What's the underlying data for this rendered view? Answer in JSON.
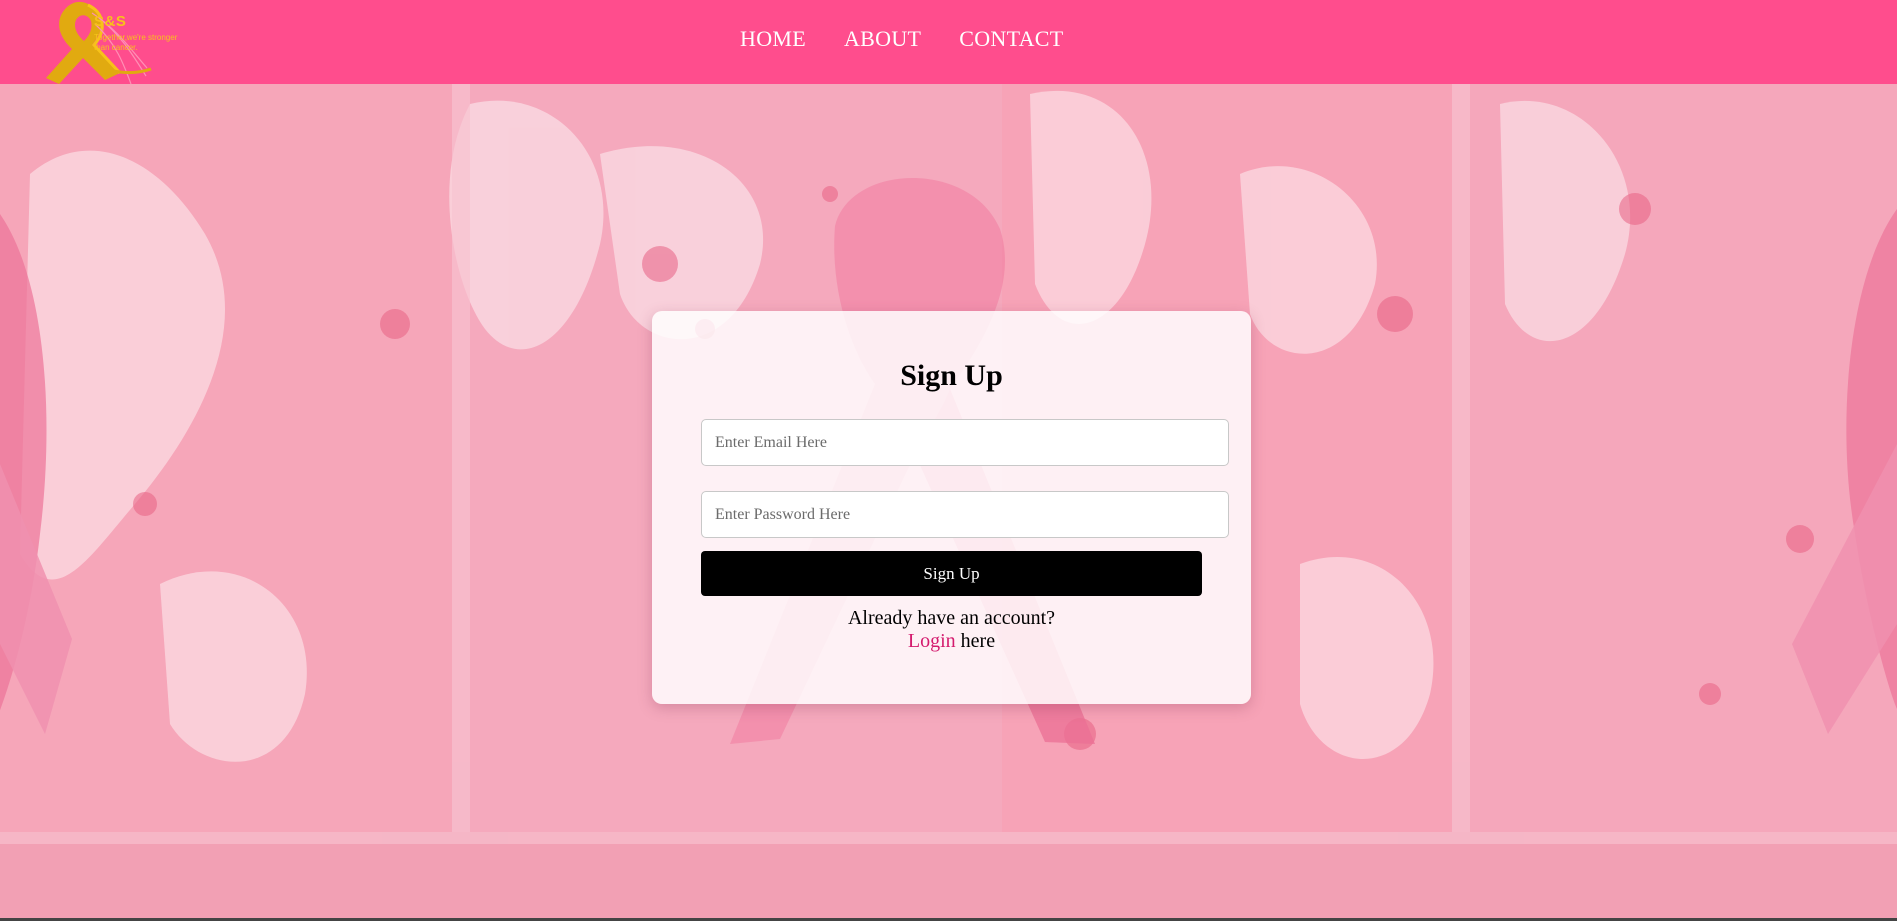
{
  "brand": {
    "name": "S&S",
    "tagline": "Together,we're stronger than cancer."
  },
  "nav": {
    "home": "HOME",
    "about": "ABOUT",
    "contact": "CONTACT"
  },
  "form": {
    "title": "Sign Up",
    "email_placeholder": "Enter Email Here",
    "email_value": "",
    "password_placeholder": "Enter Password Here",
    "password_value": "",
    "submit_label": "Sign Up",
    "account_prompt": "Already have an account?",
    "login_link": "Login",
    "login_suffix": " here"
  },
  "colors": {
    "header_bg": "#ff4d8d",
    "logo_gold": "#f7c21a",
    "link": "#d41b6e",
    "button_bg": "#000000",
    "background_pink": "#f39aae"
  }
}
